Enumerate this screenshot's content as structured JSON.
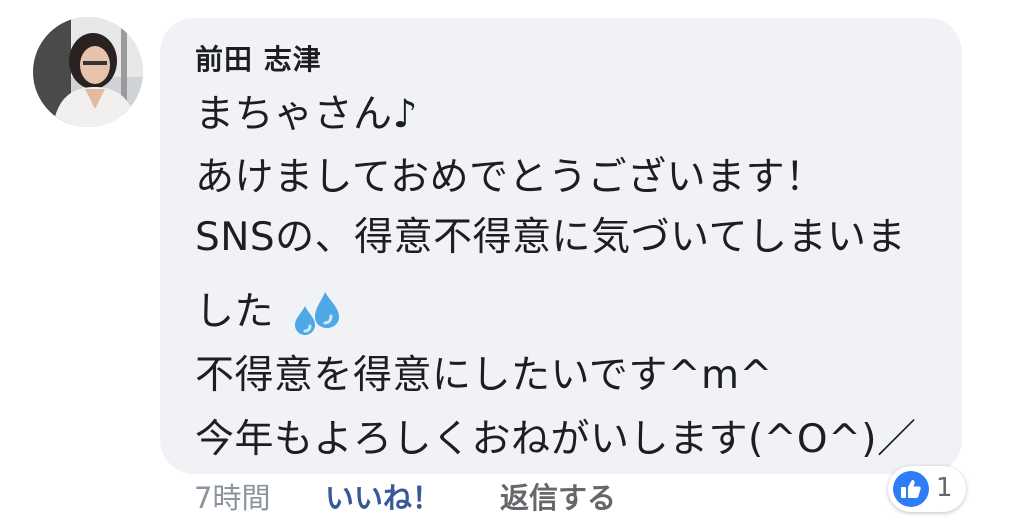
{
  "comment": {
    "author": "前田 志津",
    "lines": [
      "まちゃさん♪",
      "あけましておめでとうございます！",
      "SNSの、得意不得意に気づいてしまいま",
      "した",
      "不得意を得意にしたいです^m^",
      "今年もよろしくおねがいします(^O^)／"
    ],
    "emoji": "sweat-droplets-icon"
  },
  "actions": {
    "time": "7時間",
    "like_label": "いいね！",
    "reply_label": "返信する"
  },
  "reactions": {
    "icon": "thumbs-up-icon",
    "count": "1"
  },
  "colors": {
    "bubble": "#f0f2f5",
    "like_link": "#385898",
    "reaction_badge": "#2f7df6"
  }
}
